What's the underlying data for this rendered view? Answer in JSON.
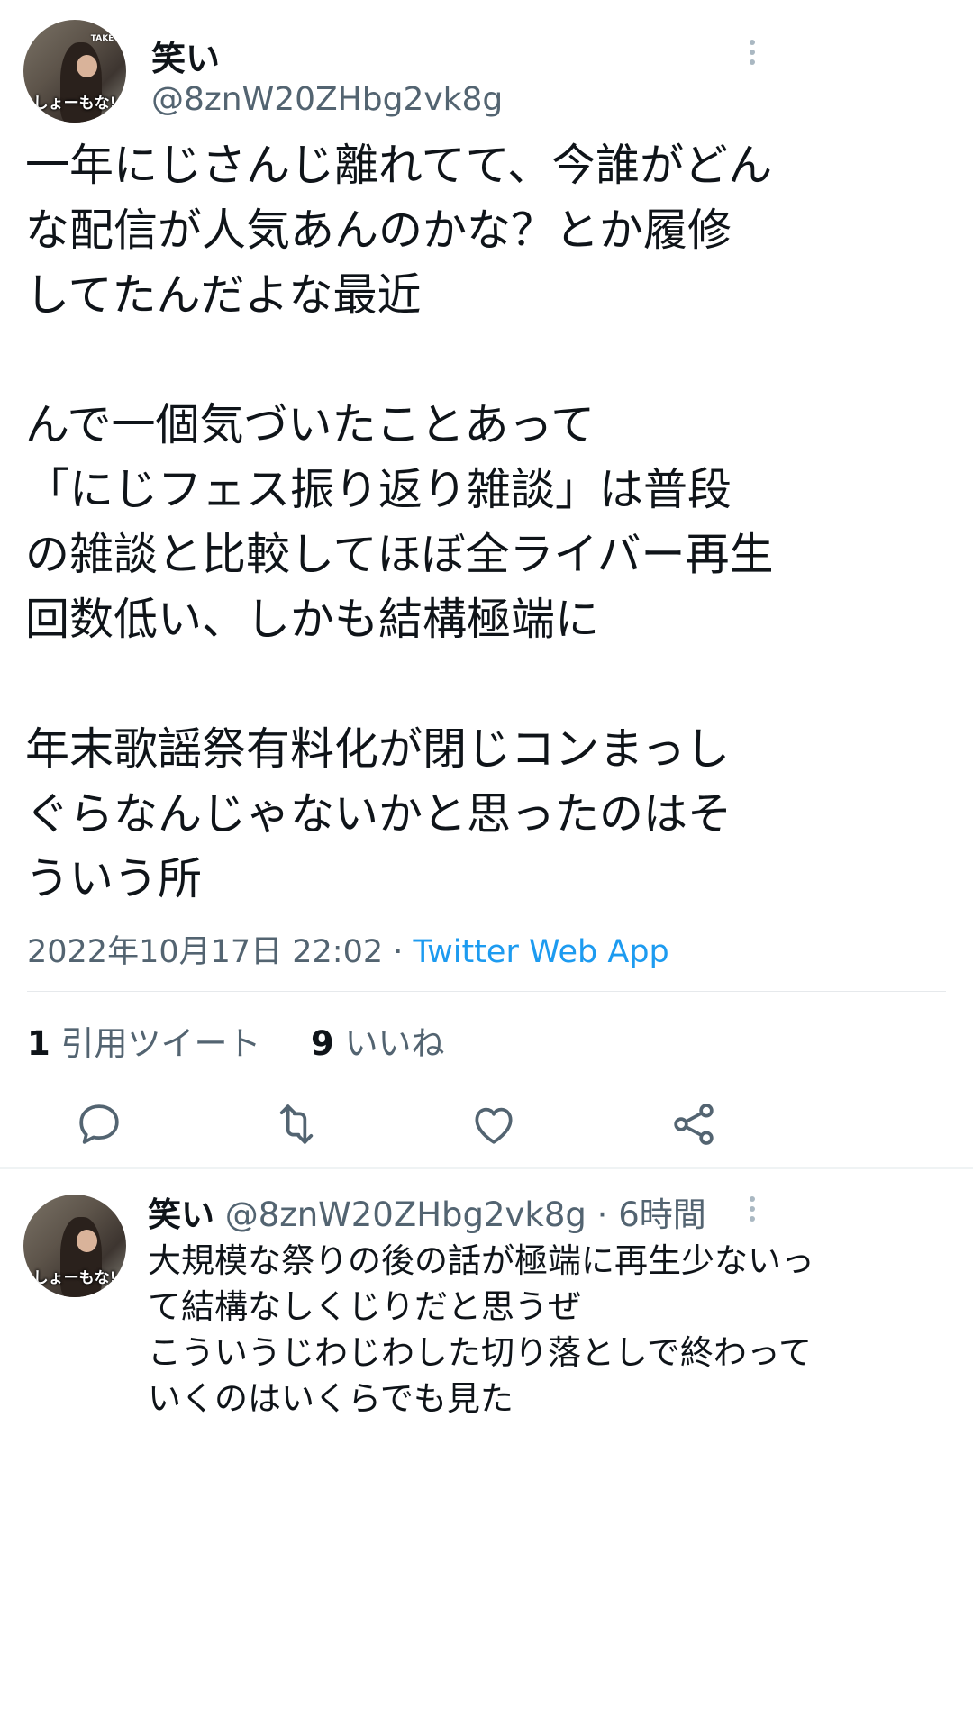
{
  "main_tweet": {
    "author_name": "笑い",
    "author_handle": "@8znW20ZHbg2vk8g",
    "avatar_caption": "しょーもな!",
    "avatar_tag": "TAKE",
    "text": "一年にじさんじ離れてて、今誰がどん\nな配信が人気あんのかな？とか履修\nしてたんだよな最近\n\nんで一個気づいたことあって\n「にじフェス振り返り雑談」は普段\nの雑談と比較してほぼ全ライバー再生\n回数低い、しかも結構極端に\n\n年末歌謡祭有料化が閉じコンまっし\nぐらなんじゃないかと思ったのはそ\nういう所",
    "date": "2022年10月17日 22:02",
    "separator": " · ",
    "source": "Twitter Web App",
    "quote_count": "1",
    "quote_label": "引用ツイート",
    "like_count": "9",
    "like_label": "いいね"
  },
  "actions": [
    {
      "name": "reply-icon"
    },
    {
      "name": "retweet-icon"
    },
    {
      "name": "like-icon"
    },
    {
      "name": "share-icon"
    }
  ],
  "reply": {
    "author_name": "笑い",
    "author_handle": "@8znW20ZHbg2vk8g",
    "separator": " · ",
    "time": "6時間",
    "avatar_caption": "しょーもな!",
    "text": "大規模な祭りの後の話が極端に再生少ないっ\nて結構なしくじりだと思うぜ\nこういうじわじわした切り落としで終わって\nいくのはいくらでも見た"
  },
  "colors": {
    "text": "#0f1419",
    "secondary": "#536471",
    "link": "#1d9bf0",
    "icon": "#536471"
  }
}
